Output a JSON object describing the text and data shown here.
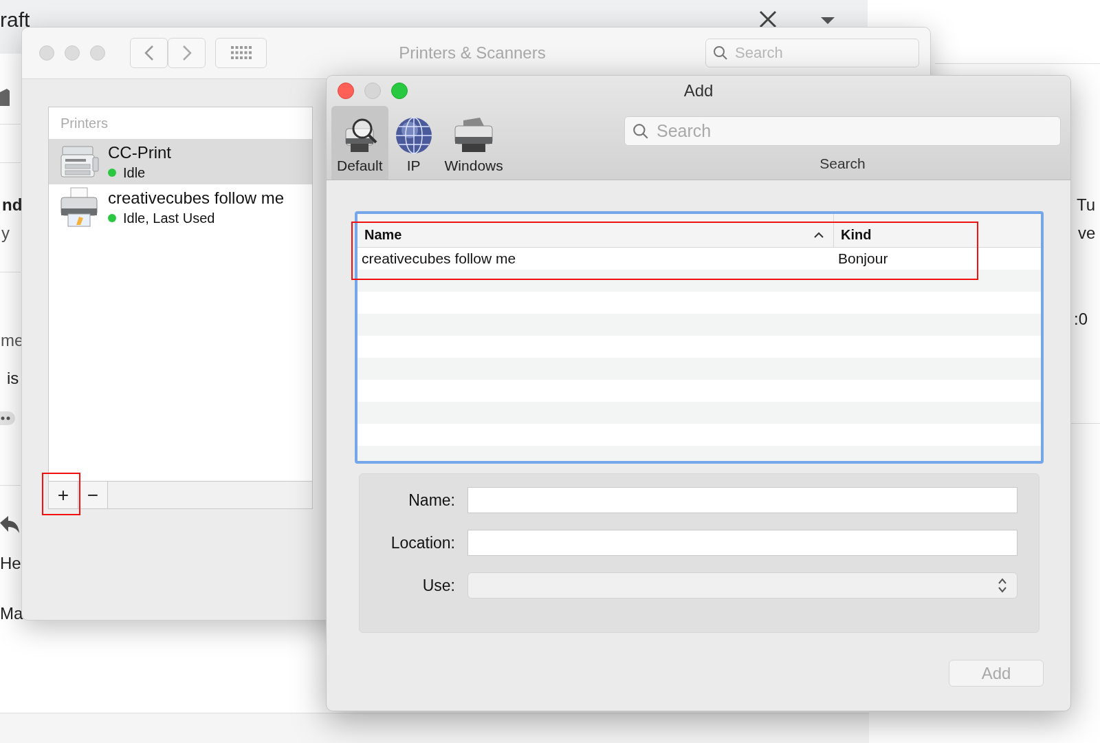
{
  "mail_background": {
    "fragments": [
      {
        "text": "raft",
        "kind": "title"
      },
      {
        "text": "nd",
        "kind": "bold"
      },
      {
        "text": "y",
        "kind": "muted"
      },
      {
        "text": "me",
        "kind": "muted"
      },
      {
        "text": "is",
        "kind": "plain"
      },
      {
        "text": "He",
        "kind": "plain"
      },
      {
        "text": "Ma",
        "kind": "plain"
      },
      {
        "text": "Tu",
        "kind": "plain"
      },
      {
        "text": "ve",
        "kind": "plain"
      },
      {
        "text": ":0",
        "kind": "plain"
      }
    ]
  },
  "printers_window": {
    "title": "Printers & Scanners",
    "search": {
      "placeholder": "Search"
    },
    "list_header": "Printers",
    "printers": [
      {
        "name": "CC-Print",
        "status": "Idle",
        "kind": "multifunction",
        "selected": true
      },
      {
        "name": "creativecubes follow me",
        "status": "Idle, Last Used",
        "kind": "printer",
        "selected": false
      }
    ],
    "list_buttons": [
      "+",
      "−"
    ]
  },
  "add_dialog": {
    "title": "Add",
    "tabs": [
      {
        "label": "Default",
        "kind": "default",
        "selected": true
      },
      {
        "label": "IP",
        "kind": "ip",
        "selected": false
      },
      {
        "label": "Windows",
        "kind": "windows",
        "selected": false
      }
    ],
    "search": {
      "placeholder": "Search",
      "label": "Search"
    },
    "table": {
      "columns": [
        {
          "label": "Name",
          "sorted": true
        },
        {
          "label": "Kind",
          "sorted": false
        }
      ],
      "rows": [
        {
          "name": "creativecubes follow me",
          "kind": "Bonjour"
        }
      ]
    },
    "form": [
      {
        "label": "Name:",
        "kind": "text"
      },
      {
        "label": "Location:",
        "kind": "text"
      },
      {
        "label": "Use:",
        "kind": "select"
      }
    ],
    "add_button": {
      "label": "Add",
      "disabled": true
    }
  },
  "highlights": {
    "table_row": true,
    "add_printer_button": true
  }
}
